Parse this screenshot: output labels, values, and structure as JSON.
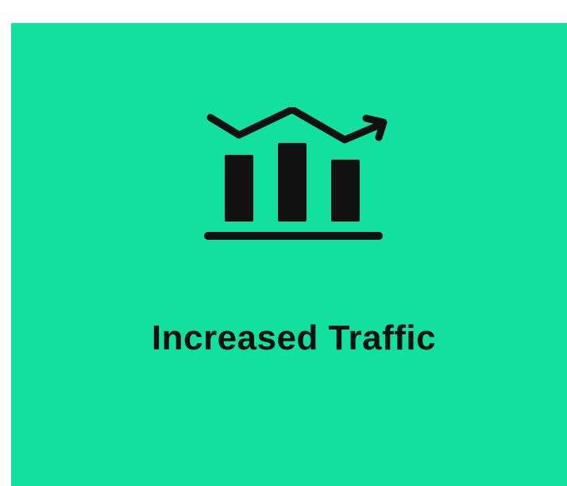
{
  "card": {
    "title": "Increased Traffic",
    "icon": "chart-trend-up-icon",
    "background_color": "#12e09e",
    "text_color": "#111111"
  }
}
